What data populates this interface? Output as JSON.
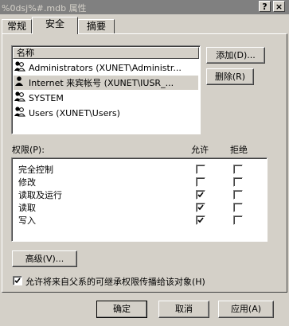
{
  "window": {
    "title": "%0dsj%#.mdb 属性",
    "help_button": "?",
    "close_button": "×"
  },
  "tabs": [
    {
      "label": "常规",
      "active": false
    },
    {
      "label": "安全",
      "active": true
    },
    {
      "label": "摘要",
      "active": false
    }
  ],
  "users_list": {
    "column_header": "名称",
    "items": [
      {
        "label": "Administrators (XUNET\\Administr...",
        "selected": false,
        "icon": "group-icon"
      },
      {
        "label": "Internet 来宾帐号  (XUNET\\IUSR_...",
        "selected": true,
        "icon": "user-icon"
      },
      {
        "label": "SYSTEM",
        "selected": false,
        "icon": "group-icon"
      },
      {
        "label": "Users (XUNET\\Users)",
        "selected": false,
        "icon": "group-icon"
      }
    ]
  },
  "buttons": {
    "add": "添加(D)...",
    "remove": "删除(R)",
    "advanced": "高级(V)...",
    "ok": "确定",
    "cancel": "取消",
    "apply": "应用(A)"
  },
  "permissions": {
    "label": "权限(P):",
    "allow_header": "允许",
    "deny_header": "拒绝",
    "rows": [
      {
        "name": "完全控制",
        "allow": false,
        "deny": false
      },
      {
        "name": "修改",
        "allow": false,
        "deny": false
      },
      {
        "name": "读取及运行",
        "allow": true,
        "deny": false
      },
      {
        "name": "读取",
        "allow": true,
        "deny": false
      },
      {
        "name": "写入",
        "allow": true,
        "deny": false
      }
    ]
  },
  "inherit_checkbox": {
    "label": "允许将来自父系的可继承权限传播给该对象(H)",
    "checked": true
  }
}
